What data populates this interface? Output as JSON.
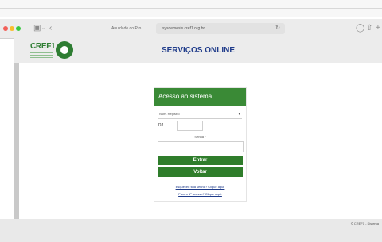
{
  "browser": {
    "tab_title": "Anuidade do Pro...",
    "address": "sysdemosis.cref1.org.br",
    "icons": [
      "sidebar-icon",
      "chevron-down-icon",
      "back-arrow-icon",
      "reload-icon",
      "shield-icon",
      "share-icon",
      "new-tab-icon"
    ]
  },
  "site": {
    "logo_text": "CREF1",
    "title": "SERVIÇOS ONLINE",
    "brand_color": "#2e7d32",
    "title_color": "#1f3b8a"
  },
  "login": {
    "header": "Acesso ao sistema",
    "select_value": "Núm. Registro",
    "uf": "RJ",
    "separator": "-",
    "registration_value": "",
    "password_label": "Senha *",
    "password_value": "",
    "enter_button": "Entrar",
    "back_button": "Voltar",
    "forgot_link": "Esqueceu sua senha? Clique aqui.",
    "first_access_link": "Para o 1º acesso? Clique aqui."
  },
  "footer": {
    "text": "© CREF1 - Sistema"
  }
}
